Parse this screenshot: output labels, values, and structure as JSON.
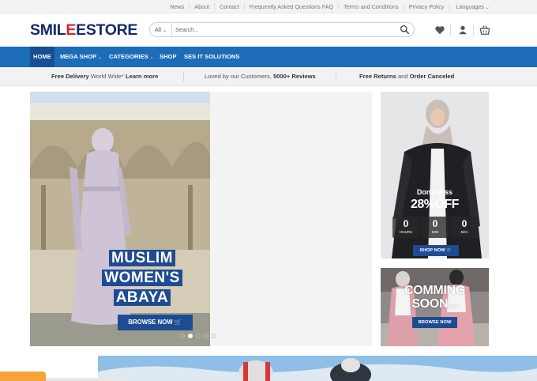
{
  "topbar": {
    "links": [
      "News",
      "About",
      "Contact",
      "Frequently Asked Questions FAQ",
      "Terms and Conditions",
      "Privacy Policy"
    ],
    "language": "Languages"
  },
  "header": {
    "logo_part1": "SMIL",
    "logo_accent": "E",
    "logo_part2": "ESTORE",
    "search_category": "All",
    "search_placeholder": "Search..."
  },
  "nav": {
    "home": "HOME",
    "mega_shop": "MEGA SHOP",
    "categories": "CATEGORIES",
    "shop": "SHOP",
    "ses_it": "SES IT SOLUTIONS"
  },
  "infobar": {
    "delivery_a": "Free Delivery",
    "delivery_b": " World Wide* ",
    "delivery_c": "Learn more",
    "loved_a": "Loved by our Customers, ",
    "loved_b": "5000+ Reviews",
    "returns_a": "Free Returns",
    "returns_b": " and ",
    "returns_c": "Order Canceled"
  },
  "hero": {
    "title_line1": "MUSLIM",
    "title_line2": "WOMEN'S",
    "title_line3": "ABAYA",
    "button": "BROWSE NOW",
    "slide_count": 5,
    "active_slide": 2
  },
  "promo_sale": {
    "headline": "Don't Miss",
    "offer": "28%OFF",
    "countdown": [
      {
        "value": "0",
        "label": "HOURS"
      },
      {
        "value": "0",
        "label": "MIN"
      },
      {
        "value": "0",
        "label": "SEC"
      }
    ],
    "button": "SHOP NOW"
  },
  "promo_coming": {
    "line1": "COMMING",
    "line2": "SOON...",
    "button": "BROWSE NOW"
  },
  "colors": {
    "nav_blue": "#1c6cb8",
    "nav_active": "#164f92",
    "button_blue": "#1f4b93",
    "logo_navy": "#162a6b",
    "logo_red": "#d9222a",
    "tag_orange": "#f7a33a"
  }
}
